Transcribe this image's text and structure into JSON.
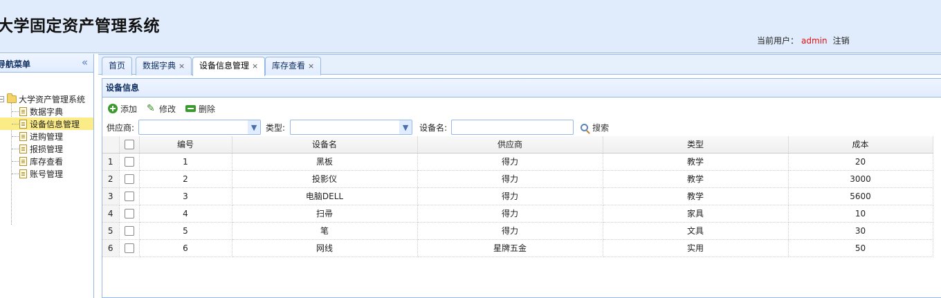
{
  "app": {
    "title": "大学固定资产管理系统"
  },
  "user": {
    "label": "当前用户：",
    "name": "admin",
    "logout": "注销"
  },
  "sidebar": {
    "title": "导航菜单",
    "root": "大学资产管理系统",
    "items": [
      {
        "label": "数据字典"
      },
      {
        "label": "设备信息管理",
        "selected": true
      },
      {
        "label": "进购管理"
      },
      {
        "label": "报损管理"
      },
      {
        "label": "库存查看"
      },
      {
        "label": "账号管理"
      }
    ]
  },
  "tabs": [
    {
      "label": "首页",
      "closable": false
    },
    {
      "label": "数据字典",
      "closable": true
    },
    {
      "label": "设备信息管理",
      "closable": true,
      "active": true
    },
    {
      "label": "库存查看",
      "closable": true
    }
  ],
  "panel": {
    "title": "设备信息"
  },
  "toolbar": {
    "add": "添加",
    "edit": "修改",
    "delete": "删除"
  },
  "search": {
    "supplier_label": "供应商:",
    "supplier_value": "",
    "type_label": "类型:",
    "type_value": "",
    "name_label": "设备名:",
    "name_value": "",
    "button": "搜索"
  },
  "grid": {
    "columns": [
      "编号",
      "设备名",
      "供应商",
      "类型",
      "成本"
    ],
    "rows": [
      {
        "rn": "1",
        "id": "1",
        "name": "黑板",
        "supplier": "得力",
        "type": "教学",
        "cost": "20"
      },
      {
        "rn": "2",
        "id": "2",
        "name": "投影仪",
        "supplier": "得力",
        "type": "教学",
        "cost": "3000"
      },
      {
        "rn": "3",
        "id": "3",
        "name": "电脑DELL",
        "supplier": "得力",
        "type": "教学",
        "cost": "5600"
      },
      {
        "rn": "4",
        "id": "4",
        "name": "扫帚",
        "supplier": "得力",
        "type": "家具",
        "cost": "10"
      },
      {
        "rn": "5",
        "id": "5",
        "name": "笔",
        "supplier": "得力",
        "type": "文具",
        "cost": "30"
      },
      {
        "rn": "6",
        "id": "6",
        "name": "网线",
        "supplier": "星牌五金",
        "type": "实用",
        "cost": "50"
      }
    ]
  },
  "colors": {
    "accent": "#95b8e7",
    "selected": "#fbec88",
    "user_name": "#dd1111"
  }
}
